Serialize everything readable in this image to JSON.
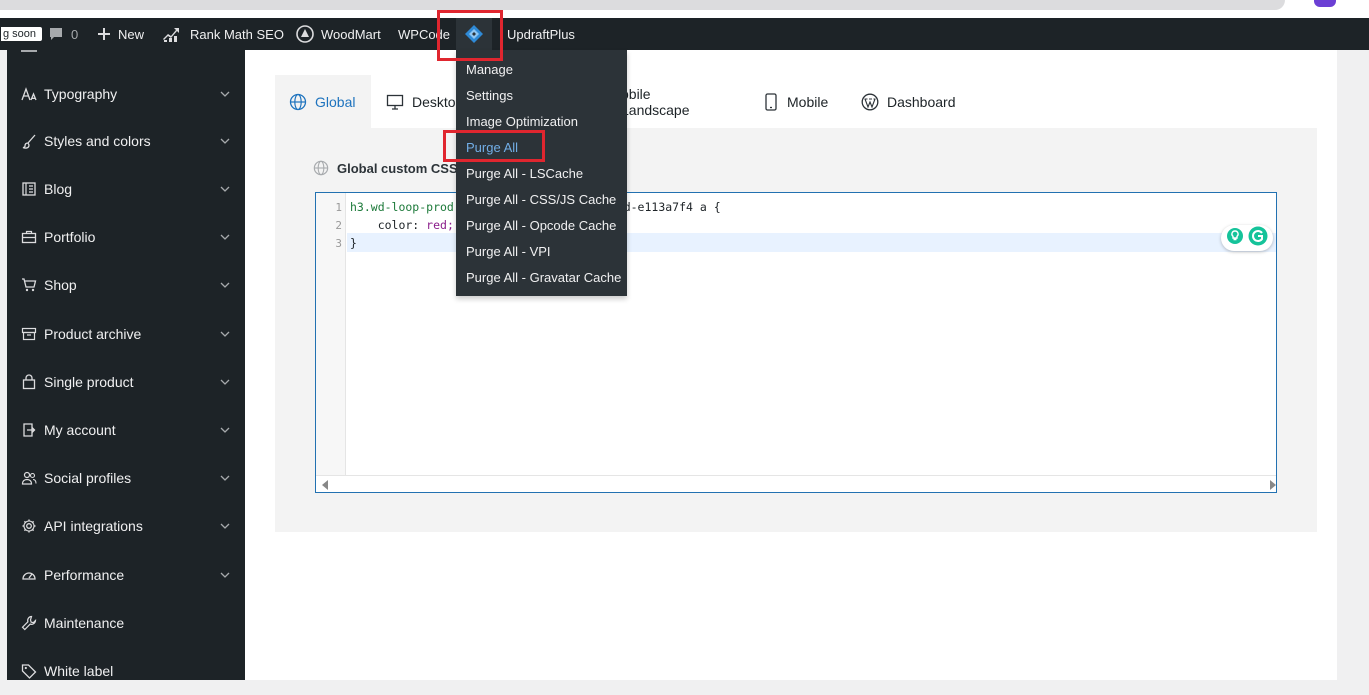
{
  "colors": {
    "admin_bar": "#1d2327",
    "sidebar": "#1d2327",
    "dropdown": "#2c3338",
    "accent": "#1e73be",
    "highlight_text": "#72aee6",
    "annotation_red": "#e0262f"
  },
  "admin_bar": {
    "coming_soon": "g soon",
    "comments_count": "0",
    "new_label": "New",
    "rank_math_label": "Rank Math SEO",
    "woodmart_label": "WoodMart",
    "wpcode_label": "WPCode",
    "litespeed_icon": "litespeed-diamond-icon",
    "updraft_label": "UpdraftPlus"
  },
  "litespeed_menu": {
    "items": [
      {
        "label": "Manage"
      },
      {
        "label": "Settings"
      },
      {
        "label": "Image Optimization"
      },
      {
        "label": "Purge All"
      },
      {
        "label": "Purge All - LSCache"
      },
      {
        "label": "Purge All - CSS/JS Cache"
      },
      {
        "label": "Purge All - Opcode Cache"
      },
      {
        "label": "Purge All - VPI"
      },
      {
        "label": "Purge All - Gravatar Cache"
      }
    ]
  },
  "sidebar": {
    "items": [
      {
        "label": "Typography",
        "icon": "typography-icon"
      },
      {
        "label": "Styles and colors",
        "icon": "brush-icon"
      },
      {
        "label": "Blog",
        "icon": "blog-icon"
      },
      {
        "label": "Portfolio",
        "icon": "briefcase-icon"
      },
      {
        "label": "Shop",
        "icon": "cart-icon"
      },
      {
        "label": "Product archive",
        "icon": "archive-icon"
      },
      {
        "label": "Single product",
        "icon": "bag-icon"
      },
      {
        "label": "My account",
        "icon": "login-icon"
      },
      {
        "label": "Social profiles",
        "icon": "users-icon"
      },
      {
        "label": "API integrations",
        "icon": "gear-icon"
      },
      {
        "label": "Performance",
        "icon": "gauge-icon"
      },
      {
        "label": "Maintenance",
        "icon": "wrench-icon"
      },
      {
        "label": "White label",
        "icon": "tag-icon"
      }
    ]
  },
  "tabs": [
    {
      "label": "Global",
      "icon": "globe-icon"
    },
    {
      "label": "Deskto",
      "icon": "desktop-icon"
    },
    {
      "label": "obile Landscape",
      "icon": ""
    },
    {
      "label": "Mobile",
      "icon": "mobile-icon"
    },
    {
      "label": "Dashboard",
      "icon": "wordpress-icon"
    }
  ],
  "panel": {
    "title": "Global custom CSS"
  },
  "editor": {
    "line_numbers": [
      "1",
      "2",
      "3"
    ],
    "line1_selector": "h3.wd-loop-prod",
    "line1_rest": ".wd-e113a7f4 a {",
    "line2_prop": "    color: ",
    "line2_value": "red;",
    "line3": "}"
  }
}
